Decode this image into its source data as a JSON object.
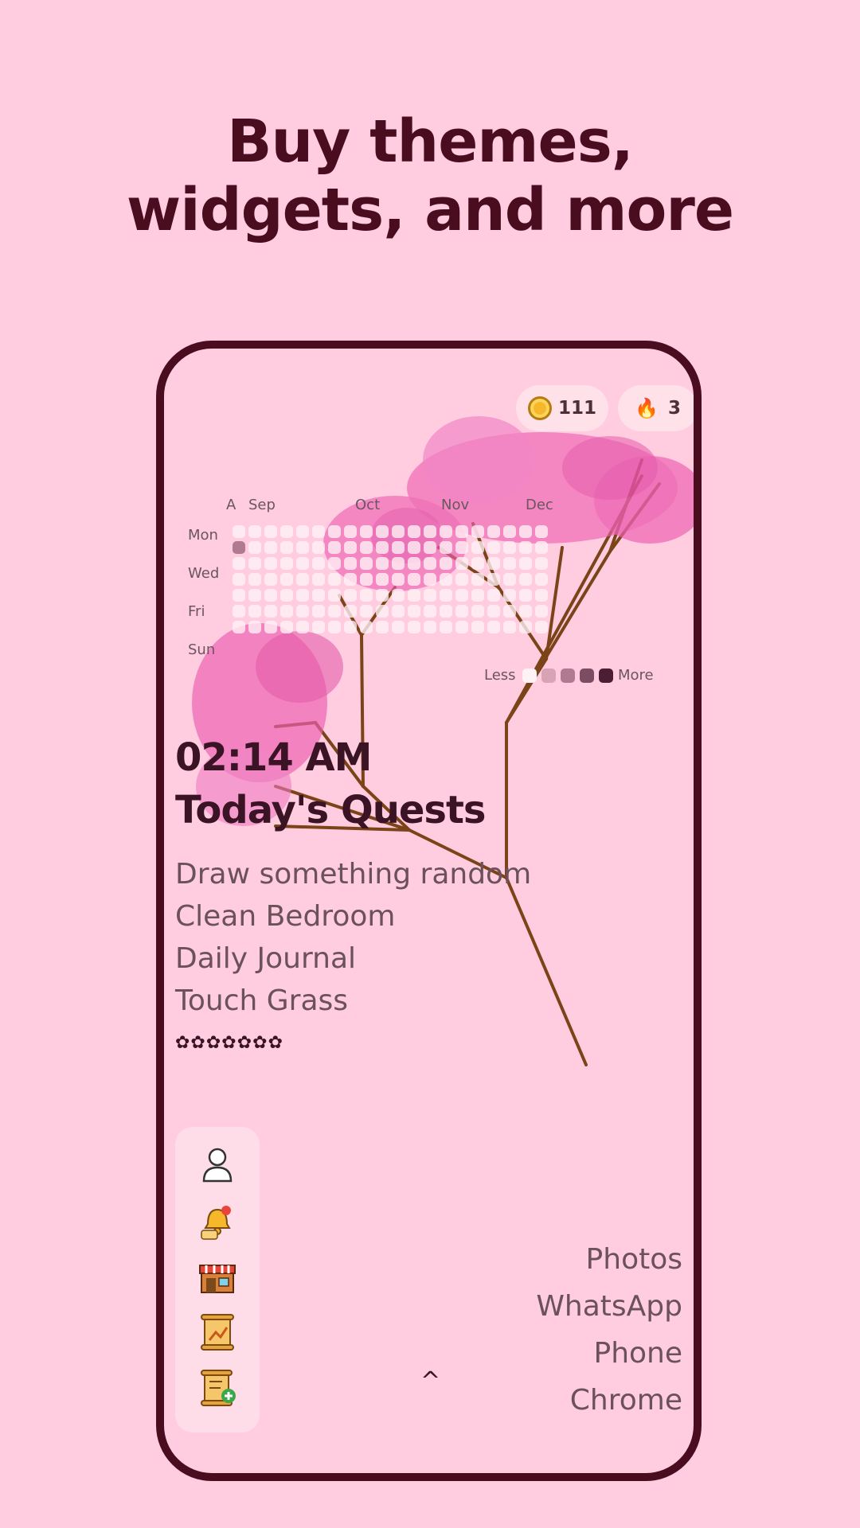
{
  "headline": {
    "line1": "Buy themes,",
    "line2": "widgets, and more"
  },
  "status": {
    "coins": "111",
    "streak": "3"
  },
  "heatmap": {
    "months": [
      "A",
      "Sep",
      "Oct",
      "Nov",
      "Dec"
    ],
    "days": [
      "Mon",
      "Wed",
      "Fri",
      "Sun"
    ],
    "legend_less": "Less",
    "legend_more": "More",
    "colors": [
      "#fff2f6",
      "#d9a3b6",
      "#b07a90",
      "#7c4d62",
      "#4c1e33"
    ]
  },
  "clock": "02:14 AM",
  "quests": {
    "title": "Today's Quests",
    "items": [
      "Draw something random",
      "Clean Bedroom",
      "Daily Journal",
      "Touch Grass"
    ],
    "stars": "✿✿✿✿✿✿✿"
  },
  "dock": {
    "icons": [
      "profile-icon",
      "notification-bell-icon",
      "shop-icon",
      "stats-scroll-icon",
      "add-quest-scroll-icon"
    ]
  },
  "drawer_caret": "^",
  "apps": [
    "Photos",
    "WhatsApp",
    "Phone",
    "Chrome"
  ],
  "colors": {
    "background": "#ffcce0",
    "accent": "#4a0d20",
    "blossom": "#ec5fb0",
    "branch": "#7a4418"
  }
}
